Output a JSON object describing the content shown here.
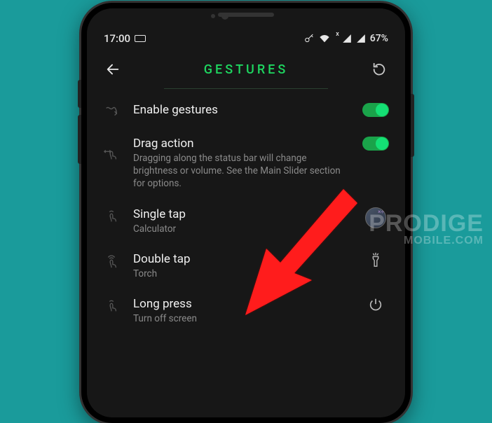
{
  "status": {
    "time": "17:00",
    "battery": "67%",
    "signal_text": "x"
  },
  "header": {
    "title": "GESTURES"
  },
  "rows": {
    "enable": {
      "title": "Enable gestures",
      "toggle": true
    },
    "drag": {
      "title": "Drag action",
      "sub": "Dragging along the status bar will change brightness or volume. See the Main Slider section for options.",
      "toggle": true
    },
    "single": {
      "title": "Single tap",
      "sub": "Calculator"
    },
    "double": {
      "title": "Double tap",
      "sub": "Torch"
    },
    "long": {
      "title": "Long press",
      "sub": "Turn off screen"
    }
  },
  "watermark": {
    "line1": "PRODIGE",
    "line2": "MOBILE.COM"
  }
}
